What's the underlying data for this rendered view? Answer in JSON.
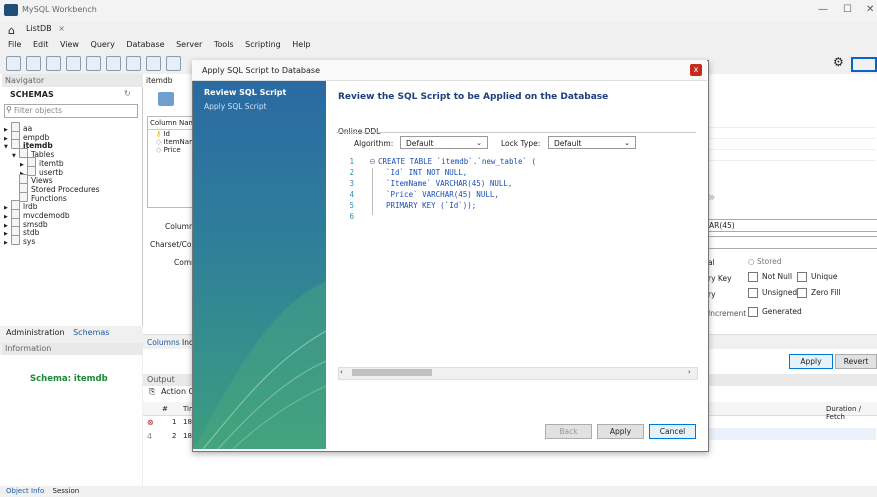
{
  "window": {
    "title": "MySQL Workbench",
    "tab": "ListDB",
    "tab_close": "×",
    "minimize": "—",
    "maximize": "☐",
    "close": "✕"
  },
  "menu": [
    "File",
    "Edit",
    "View",
    "Query",
    "Database",
    "Server",
    "Tools",
    "Scripting",
    "Help"
  ],
  "navigator": {
    "header": "Navigator",
    "schemas_label": "SCHEMAS",
    "filter_placeholder": "Filter objects",
    "tree": [
      {
        "label": "aa",
        "level": 0,
        "bold": false,
        "arrow": "▶"
      },
      {
        "label": "empdb",
        "level": 0,
        "bold": false,
        "arrow": "▶"
      },
      {
        "label": "itemdb",
        "level": 0,
        "bold": true,
        "arrow": "▼"
      },
      {
        "label": "Tables",
        "level": 1,
        "bold": false,
        "arrow": "▼"
      },
      {
        "label": "itemtb",
        "level": 2,
        "bold": false,
        "arrow": "▶"
      },
      {
        "label": "usertb",
        "level": 2,
        "bold": false,
        "arrow": "▶"
      },
      {
        "label": "Views",
        "level": 1,
        "bold": false,
        "arrow": ""
      },
      {
        "label": "Stored Procedures",
        "level": 1,
        "bold": false,
        "arrow": ""
      },
      {
        "label": "Functions",
        "level": 1,
        "bold": false,
        "arrow": ""
      },
      {
        "label": "lrdb",
        "level": 0,
        "bold": false,
        "arrow": "▶"
      },
      {
        "label": "mvcdemodb",
        "level": 0,
        "bold": false,
        "arrow": "▶"
      },
      {
        "label": "smsdb",
        "level": 0,
        "bold": false,
        "arrow": "▶"
      },
      {
        "label": "stdb",
        "level": 0,
        "bold": false,
        "arrow": "▶"
      },
      {
        "label": "sys",
        "level": 0,
        "bold": false,
        "arrow": "▶"
      }
    ],
    "tabs": [
      "Administration",
      "Schemas"
    ],
    "information_header": "Information",
    "schema_info": "Schema: itemdb",
    "object_tabs": [
      "Object Info",
      "Session"
    ]
  },
  "editor": {
    "tab": "itemdb",
    "column_header": "Column Name",
    "columns": [
      "Id",
      "ItemNam",
      "Price"
    ],
    "column_name_label": "Column Na",
    "charset_label": "Charset/Colla",
    "comments_label": "Comme",
    "datatype_value": "AR(45)",
    "storage_virtual": "al",
    "storage_stored": "Stored",
    "flags_row1_prefix": "ry Key",
    "flags_row2_prefix": "ry",
    "flags_row3_prefix": "Increment",
    "not_null": "Not Null",
    "unique": "Unique",
    "unsigned": "Unsigned",
    "zero_fill": "Zero Fill",
    "generated": "Generated",
    "bottom_tabs": [
      "Columns",
      "Inc"
    ],
    "apply": "Apply",
    "revert": "Revert"
  },
  "output": {
    "header": "Output",
    "action_output": "Action Ou",
    "col_hash": "#",
    "col_time": "Tim",
    "col_duration": "Duration / Fetch",
    "rows": [
      {
        "num": "1",
        "time": "18:"
      },
      {
        "num": "2",
        "time": "18:"
      }
    ]
  },
  "dialog": {
    "title": "Apply SQL Script to Database",
    "close": "x",
    "steps": [
      "Review SQL Script",
      "Apply SQL Script"
    ],
    "heading": "Review the SQL Script to be Applied on the Database",
    "online_ddl": "Online DDL",
    "algorithm_label": "Algorithm:",
    "algorithm_value": "Default",
    "lock_label": "Lock Type:",
    "lock_value": "Default",
    "sql": [
      {
        "n": "1",
        "text": "CREATE TABLE `itemdb`.`new_table` ("
      },
      {
        "n": "2",
        "text": "`Id` INT NOT NULL,"
      },
      {
        "n": "3",
        "text": "`ItemName` VARCHAR(45) NULL,"
      },
      {
        "n": "4",
        "text": "`Price` VARCHAR(45) NULL,"
      },
      {
        "n": "5",
        "text": "PRIMARY KEY (`Id`));"
      },
      {
        "n": "6",
        "text": ""
      }
    ],
    "back": "Back",
    "apply": "Apply",
    "cancel": "Cancel"
  }
}
